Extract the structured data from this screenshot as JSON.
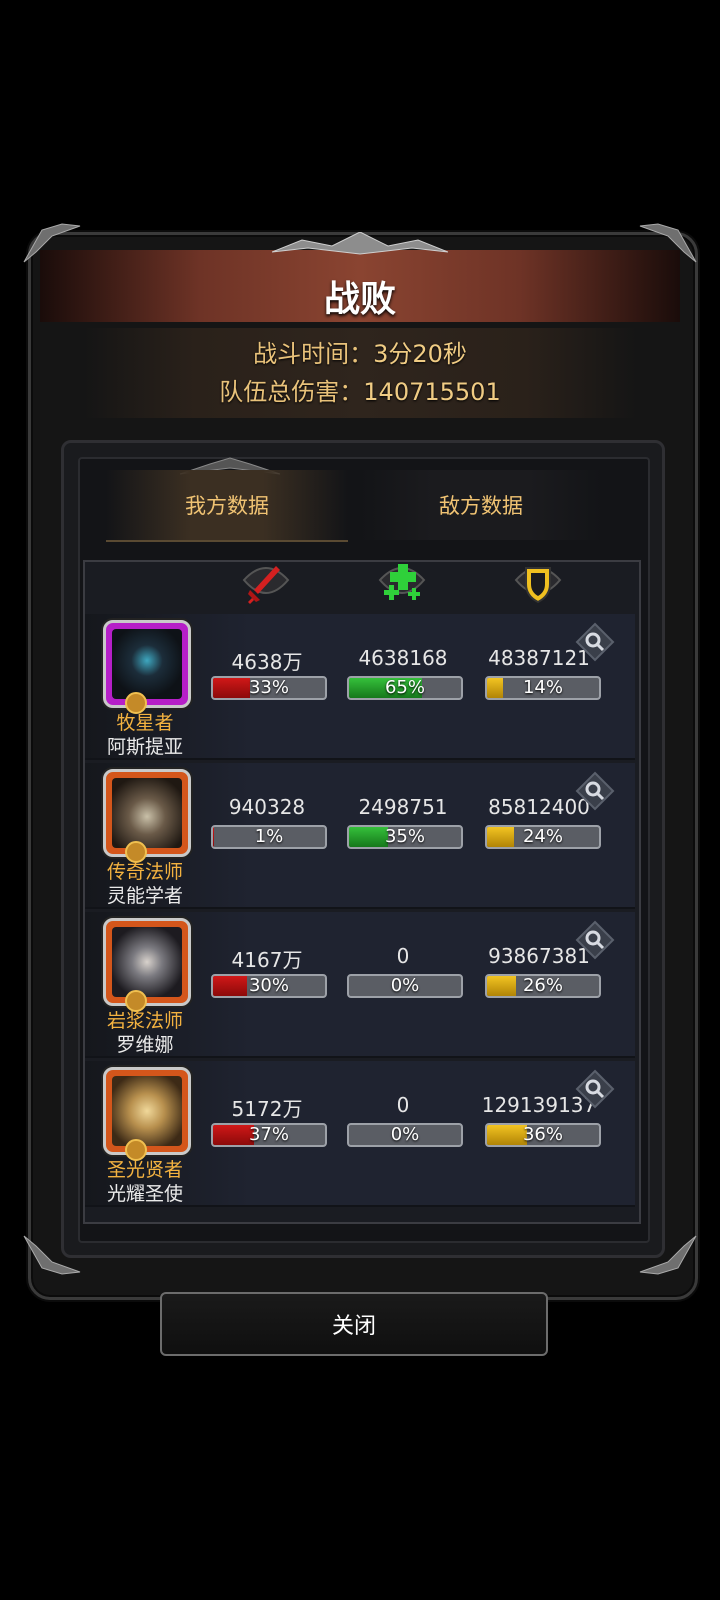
{
  "header": {
    "title": "战败",
    "battle_time_label": "战斗时间：",
    "battle_time_value": "3分20秒",
    "total_damage_label": "队伍总伤害：",
    "total_damage_value": "140715501"
  },
  "tabs": [
    {
      "label": "我方数据",
      "active": true
    },
    {
      "label": "敌方数据",
      "active": false
    }
  ],
  "columns": [
    {
      "icon": "sword-icon",
      "color": "#d02020"
    },
    {
      "icon": "heal-plus-icon",
      "color": "#2fd03a"
    },
    {
      "icon": "shield-icon",
      "color": "#f0c020"
    }
  ],
  "heroes": [
    {
      "title": "牧星者",
      "name": "阿斯提亚",
      "frame_color": "#b61fc8",
      "damage": "4638万",
      "damage_pct": "33%",
      "damage_fill": 0.33,
      "heal": "4638168",
      "heal_pct": "65%",
      "heal_fill": 0.65,
      "tank": "48387121",
      "tank_pct": "14%",
      "tank_fill": 0.14
    },
    {
      "title": "传奇法师",
      "name": "灵能学者",
      "frame_color": "#d4561b",
      "damage": "940328",
      "damage_pct": "1%",
      "damage_fill": 0.01,
      "heal": "2498751",
      "heal_pct": "35%",
      "heal_fill": 0.35,
      "tank": "85812400",
      "tank_pct": "24%",
      "tank_fill": 0.24
    },
    {
      "title": "岩浆法师",
      "name": "罗维娜",
      "frame_color": "#d4561b",
      "damage": "4167万",
      "damage_pct": "30%",
      "damage_fill": 0.3,
      "heal": "0",
      "heal_pct": "0%",
      "heal_fill": 0,
      "tank": "93867381",
      "tank_pct": "26%",
      "tank_fill": 0.26
    },
    {
      "title": "圣光贤者",
      "name": "光耀圣使",
      "frame_color": "#d4561b",
      "damage": "5172万",
      "damage_pct": "37%",
      "damage_fill": 0.37,
      "heal": "0",
      "heal_pct": "0%",
      "heal_fill": 0,
      "tank": "129139137",
      "tank_pct": "36%",
      "tank_fill": 0.36
    }
  ],
  "close_label": "关闭"
}
